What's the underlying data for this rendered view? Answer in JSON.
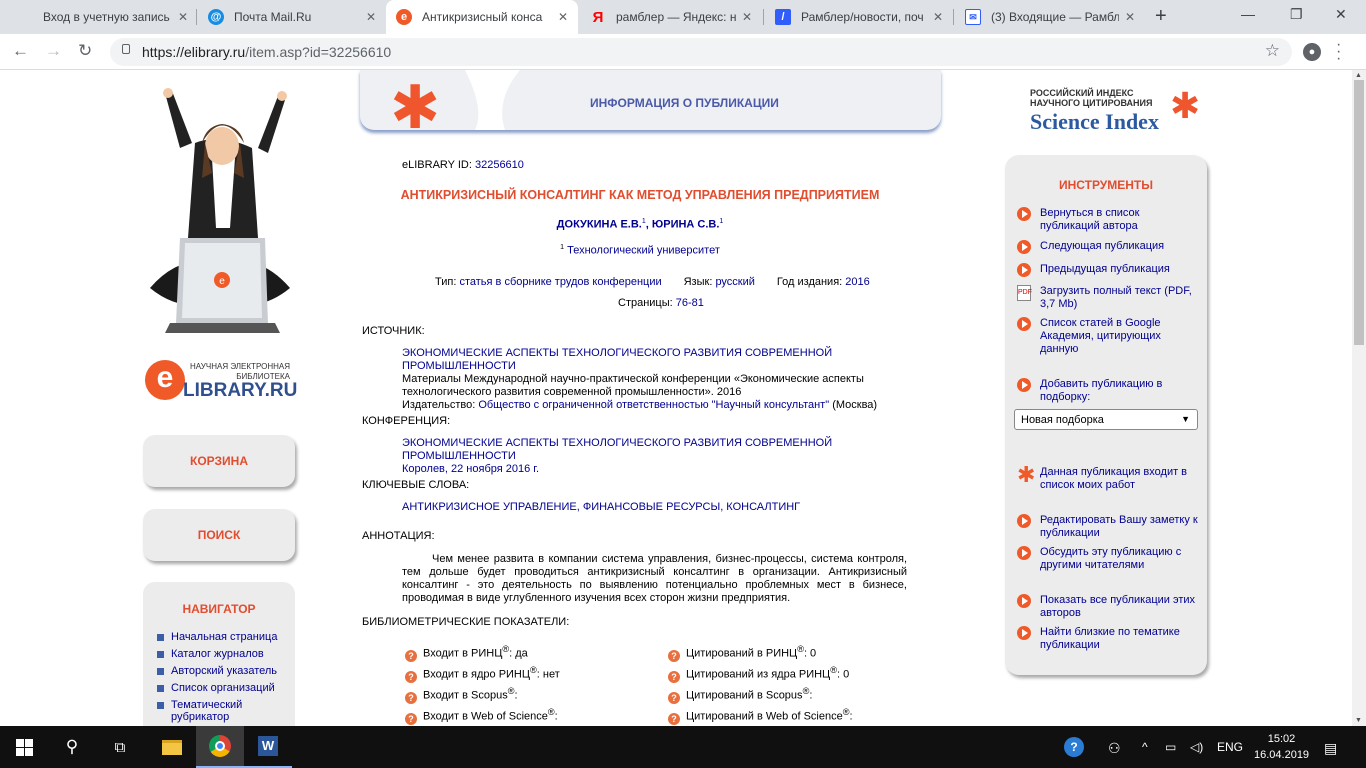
{
  "tabs": [
    {
      "title": "Вход в учетную запись",
      "icon": "microsoft-icon",
      "color": "#f35325"
    },
    {
      "title": "Почта Mail.Ru",
      "icon": "mailru-icon",
      "color": "#168de2"
    },
    {
      "title": "Антикризисный конса",
      "icon": "elibrary-icon",
      "color": "#f05a28"
    },
    {
      "title": "рамблер — Яндекс: на",
      "icon": "yandex-icon",
      "color": "#ff0000"
    },
    {
      "title": "Рамблер/новости, поч",
      "icon": "rambler-icon",
      "color": "#315efb"
    },
    {
      "title": "(3) Входящие — Рамбл",
      "icon": "mail-icon",
      "color": "#315efb"
    }
  ],
  "url": {
    "host": "https://elibrary.ru",
    "path": "/item.asp?id=32256610"
  },
  "left": {
    "logo_small": "НАУЧНАЯ ЭЛЕКТРОННАЯ БИБЛИОТЕКА",
    "logo_big": "LIBRARY.RU",
    "logo_e": "e",
    "cart": "КОРЗИНА",
    "search": "ПОИСК",
    "nav_title": "НАВИГАТОР",
    "nav_items": [
      "Начальная страница",
      "Каталог журналов",
      "Авторский указатель",
      "Список организаций",
      "Тематический рубрикатор"
    ]
  },
  "header": {
    "title": "ИНФОРМАЦИЯ О ПУБЛИКАЦИИ"
  },
  "pub": {
    "id_label": "eLIBRARY ID:",
    "id": "32256610",
    "title": "АНТИКРИЗИСНЫЙ КОНСАЛТИНГ КАК МЕТОД УПРАВЛЕНИЯ ПРЕДПРИЯТИЕМ",
    "author1": "ДОКУКИНА Е.В.",
    "author2": "ЮРИНА С.В.",
    "sup": "1",
    "affil": "Технологический университет",
    "type_label": "Тип:",
    "type": "статья в сборнике трудов конференции",
    "lang_label": "Язык:",
    "lang": "русский",
    "year_label": "Год издания:",
    "year": "2016",
    "pages_label": "Страницы:",
    "pages": "76-81",
    "source_label": "ИСТОЧНИК:",
    "source_title": "ЭКОНОМИЧЕСКИЕ АСПЕКТЫ ТЕХНОЛОГИЧЕСКОГО РАЗВИТИЯ СОВРЕМЕННОЙ ПРОМЫШЛЕННОСТИ",
    "source_desc": "Материалы Международной научно-практической конференции «Экономические аспекты технологического развития современной промышленности». 2016",
    "publisher_label": "Издательство:",
    "publisher": "Общество с ограниченной ответственностью \"Научный консультант\"",
    "publisher_city": "(Москва)",
    "conf_label": "КОНФЕРЕНЦИЯ:",
    "conf_title": "ЭКОНОМИЧЕСКИЕ АСПЕКТЫ ТЕХНОЛОГИЧЕСКОГО РАЗВИТИЯ СОВРЕМЕННОЙ ПРОМЫШЛЕННОСТИ",
    "conf_place": "Королев, 22 ноября 2016 г.",
    "kw_label": "КЛЮЧЕВЫЕ СЛОВА:",
    "keywords": "АНТИКРИЗИСНОЕ УПРАВЛЕНИЕ, ФИНАНСОВЫЕ РЕСУРСЫ, КОНСАЛТИНГ",
    "abs_label": "АННОТАЦИЯ:",
    "abstract": "Чем менее развита в компании система управления, бизнес-процессы, система контроля, тем дольше будет проводиться антикризисный консалтинг в организации. Антикризисный консалтинг - это деятельность по выявлению потенциально проблемных мест в бизнесе, проводимая в виде углубленного изучения всех сторон жизни предприятия.",
    "biblio_label": "БИБЛИОМЕТРИЧЕСКИЕ ПОКАЗАТЕЛИ:",
    "metrics": [
      {
        "l": "Входит в РИНЦ",
        "sup": "®",
        "v": ": да",
        "l2": "Цитирований в РИНЦ",
        "v2": ": 0"
      },
      {
        "l": "Входит в ядро РИНЦ",
        "sup": "®",
        "v": ": нет",
        "l2": "Цитирований из ядра РИНЦ",
        "v2": ": 0"
      },
      {
        "l": "Входит в Scopus",
        "sup": "®",
        "v": ":",
        "l2": "Цитирований в Scopus",
        "v2": ":"
      },
      {
        "l": "Входит в Web of Science",
        "sup": "®",
        "v": ":",
        "l2": "Цитирований в Web of Science",
        "v2": ":"
      }
    ]
  },
  "right": {
    "sci_small": "РОССИЙСКИЙ ИНДЕКС НАУЧНОГО ЦИТИРОВАНИЯ",
    "sci_big": "Science Index",
    "tools_title": "ИНСТРУМЕНТЫ",
    "items": [
      "Вернуться в список публикаций автора",
      "Следующая публикация",
      "Предыдущая публикация",
      "Загрузить полный текст (PDF, 3,7 Mb)",
      "Список статей в Google Академия, цитирующих данную",
      "Добавить публикацию в подборку:",
      "Данная публикация входит в список моих работ",
      "Редактировать Вашу заметку к публикации",
      "Обсудить эту публикацию с другими читателями",
      "Показать все публикации этих авторов",
      "Найти близкие по тематике публикации"
    ],
    "select": "Новая подборка"
  },
  "taskbar": {
    "lang": "ENG",
    "time": "15:02",
    "date": "16.04.2019"
  }
}
